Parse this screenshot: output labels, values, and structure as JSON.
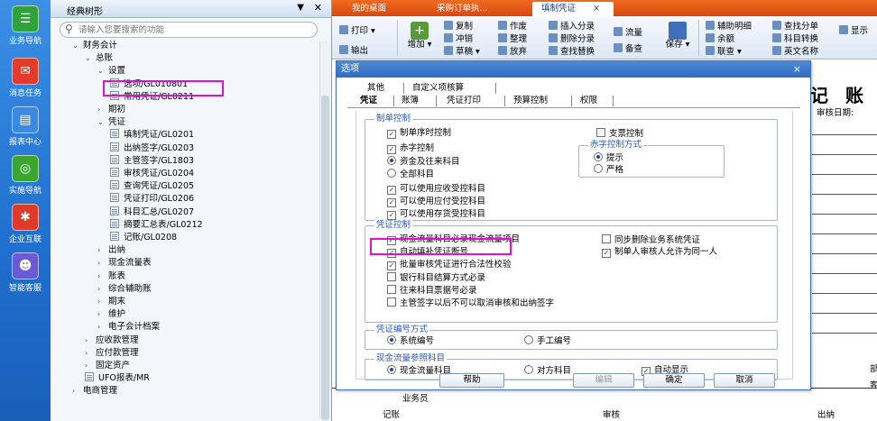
{
  "leftbar": {
    "items": [
      {
        "label": "业务导航",
        "icon": "business-nav-icon",
        "glyph": "☰",
        "color": "#2fa23a"
      },
      {
        "label": "消息任务",
        "icon": "message-icon",
        "glyph": "✉",
        "color": "#e23b2a"
      },
      {
        "label": "报表中心",
        "icon": "report-icon",
        "glyph": "▤",
        "color": "#3a8be0"
      },
      {
        "label": "实施导航",
        "icon": "implement-nav-icon",
        "glyph": "◎",
        "color": "#3aa62f"
      },
      {
        "label": "企业互联",
        "icon": "enterprise-icon",
        "glyph": "✱",
        "color": "#e0392a"
      },
      {
        "label": "智能客服",
        "icon": "service-icon",
        "glyph": "☻",
        "color": "#6a5ad6"
      }
    ]
  },
  "tree": {
    "title": "经典树形",
    "search_placeholder": "请输入您要搜索的功能",
    "nodes": [
      {
        "label": "财务会计",
        "arrow": "⌄",
        "doc": false
      },
      {
        "label": "总账",
        "arrow": "⌄",
        "doc": false
      },
      {
        "label": "设置",
        "arrow": "⌄",
        "doc": false
      },
      {
        "label": "选项/GL010801",
        "arrow": "",
        "doc": true
      },
      {
        "label": "常用凭证/GL0211",
        "arrow": "",
        "doc": true
      },
      {
        "label": "期初",
        "arrow": "›",
        "doc": false
      },
      {
        "label": "凭证",
        "arrow": "⌄",
        "doc": false
      },
      {
        "label": "填制凭证/GL0201",
        "arrow": "",
        "doc": true
      },
      {
        "label": "出纳签字/GL0203",
        "arrow": "",
        "doc": true
      },
      {
        "label": "主管签字/GL1803",
        "arrow": "",
        "doc": true
      },
      {
        "label": "审核凭证/GL0204",
        "arrow": "",
        "doc": true
      },
      {
        "label": "查询凭证/GL0205",
        "arrow": "",
        "doc": true
      },
      {
        "label": "凭证打印/GL0206",
        "arrow": "",
        "doc": true
      },
      {
        "label": "科目汇总/GL0207",
        "arrow": "",
        "doc": true
      },
      {
        "label": "摘要汇总表/GL0212",
        "arrow": "",
        "doc": true
      },
      {
        "label": "记账/GL0208",
        "arrow": "",
        "doc": true
      },
      {
        "label": "出纳",
        "arrow": "›",
        "doc": false
      },
      {
        "label": "现金流量表",
        "arrow": "›",
        "doc": false
      },
      {
        "label": "账表",
        "arrow": "›",
        "doc": false
      },
      {
        "label": "综合辅助账",
        "arrow": "›",
        "doc": false
      },
      {
        "label": "期末",
        "arrow": "›",
        "doc": false
      },
      {
        "label": "维护",
        "arrow": "›",
        "doc": false
      },
      {
        "label": "电子会计档案",
        "arrow": "›",
        "doc": false
      },
      {
        "label": "应收款管理",
        "arrow": "›",
        "doc": false
      },
      {
        "label": "应付款管理",
        "arrow": "›",
        "doc": false
      },
      {
        "label": "固定资产",
        "arrow": "›",
        "doc": false
      },
      {
        "label": "UFO报表/MR",
        "arrow": "",
        "doc": true
      },
      {
        "label": "电商管理",
        "arrow": "›",
        "doc": false
      }
    ]
  },
  "tabs": [
    {
      "label": "我的桌面",
      "active": false
    },
    {
      "label": "采购订单执...",
      "active": false
    },
    {
      "label": "填制凭证",
      "active": true,
      "close": "×"
    }
  ],
  "toolbar": {
    "print": "打印",
    "output": "输出",
    "add": "增加",
    "copy": "复制",
    "reverse": "冲销",
    "draft": "草稿",
    "void": "作废",
    "arrange": "整理",
    "abandon": "放弃",
    "insert_entry": "插入分录",
    "delete_entry": "删除分录",
    "find_replace": "查找替换",
    "cashflow": "流量",
    "memo": "备查",
    "save": "保存",
    "aux_detail": "辅助明细",
    "balance": "余额",
    "linked_query": "联查",
    "find_entry": "查找分单",
    "subject_convert": "科目转换",
    "english_name": "英文名称",
    "display": "显示"
  },
  "voucher": {
    "title": "记 账",
    "date_label": "审核日期:",
    "cashier_label": "业务员",
    "bookkeep_label": "记账",
    "audit_label": "审核",
    "cashier2_label": "出纳",
    "side1": "部",
    "side2": "客"
  },
  "dialog": {
    "title": "选项",
    "close": "×",
    "tabs_row1": [
      "其他",
      "自定义项核算"
    ],
    "tabs_row2": [
      "凭证",
      "账簿",
      "凭证打印",
      "预算控制",
      "权限"
    ],
    "group1": {
      "title": "制单控制",
      "seq_time": "制单序时控制",
      "cheque": "支票控制",
      "red_control": "赤字控制",
      "red_mode_title": "赤字控制方式",
      "funds_subject": "资金及往来科目",
      "all_subjects": "全部科目",
      "prompt": "提示",
      "strict": "严格",
      "ar": "可以使用应收受控科目",
      "ap": "可以使用应付受控科目",
      "stock": "可以使用存货受控科目"
    },
    "group2": {
      "title": "凭证控制",
      "cashflow_required": "现金流量科目必录现金流量项目",
      "sync_delete": "同步删除业务系统凭证",
      "auto_fill": "自动填补凭证断号",
      "same_person": "制单人审核人允许为同一人",
      "batch_check": "批量审核凭证进行合法性校验",
      "bank_settle": "银行科目结算方式必录",
      "bill_no": "往来科目票据号必录",
      "no_cancel": "主管签字以后不可以取消审核和出纳签字"
    },
    "group3": {
      "title": "凭证编号方式",
      "system": "系统编号",
      "manual": "手工编号"
    },
    "group4": {
      "title": "现金流量参照科目",
      "cashflow_subject": "现金流量科目",
      "opposite": "对方科目",
      "auto_show": "自动显示"
    },
    "buttons": {
      "help": "帮助",
      "edit": "编辑",
      "ok": "确定",
      "cancel": "取消"
    }
  },
  "colors": {
    "tab_orange": "#e4561a",
    "dialog_blue": "#2f6bc0",
    "highlight": "#e010d0",
    "group_title": "#2a5bb0"
  }
}
